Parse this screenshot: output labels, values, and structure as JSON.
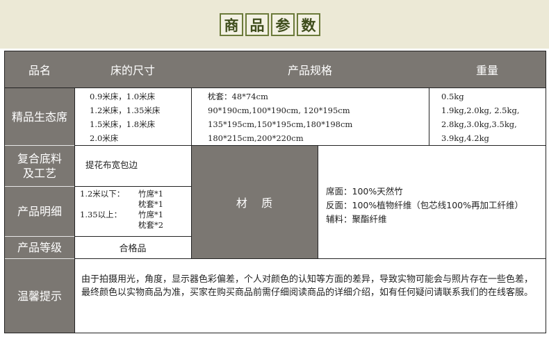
{
  "banner": {
    "chars": [
      "商",
      "品",
      "参",
      "数"
    ]
  },
  "header": {
    "col_name": "品名",
    "col_bed": "床的尺寸",
    "col_spec": "产品规格",
    "col_weight": "重量"
  },
  "row_product": {
    "label": "精品生态席",
    "bed_sizes": [
      "0.9米床，1.0米床",
      "1.2米床，1.35米床",
      "1.5米床，1.8米床",
      "2.0米床"
    ],
    "specs": [
      "枕套：48*74cm",
      "90*190cm,100*190cm, 120*195cm",
      "135*195cm,150*195cm,180*198cm",
      "180*215cm,200*220cm"
    ],
    "weights": [
      "0.5kg",
      "1.9kg,2.0kg, 2.5kg,",
      "2.8kg,3.0kg,3.5kg,",
      "3.9kg,4.2kg"
    ]
  },
  "row_material_base": {
    "label": "复合底料及工艺",
    "value": "提花布宽包边"
  },
  "row_details": {
    "label": "产品明细",
    "lines": [
      {
        "size": "1.2米以下：",
        "item": "竹席*1"
      },
      {
        "size": "",
        "item": "枕套*1"
      },
      {
        "size": "1.35以上：",
        "item": "竹席*1"
      },
      {
        "size": "",
        "item": "枕套*2"
      }
    ]
  },
  "row_grade": {
    "label": "产品等级",
    "value": "合格品"
  },
  "material": {
    "label": "材    质",
    "lines": [
      "席面：100%天然竹",
      "反面：100%植物纤维（包芯线100%再加工纤维）",
      "辅料：聚酯纤维"
    ]
  },
  "notice": {
    "label": "温馨提示",
    "text": "由于拍摄用光，角度，显示器色彩偏差，个人对颜色的认知等方面的差异，导致实物可能会与照片存在一些色差，最终颜色以实物商品为准，买家在购买商品前需仔细阅读商品的详细介绍，如有任何疑问请联系我们的在线客服。"
  }
}
